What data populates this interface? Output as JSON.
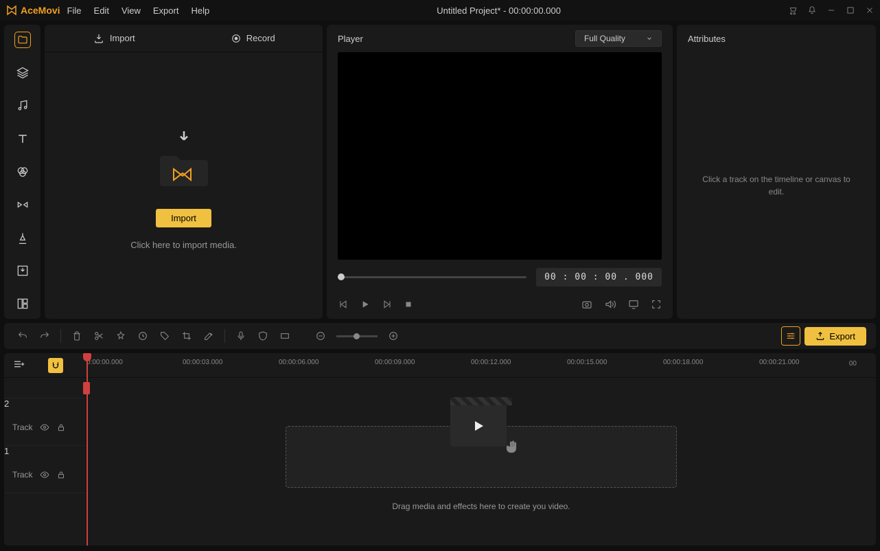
{
  "app": {
    "name": "AceMovi",
    "title": "Untitled Project* - 00:00:00.000"
  },
  "menu": [
    "File",
    "Edit",
    "View",
    "Export",
    "Help"
  ],
  "media": {
    "tabs": {
      "import": "Import",
      "record": "Record"
    },
    "import_btn": "Import",
    "import_hint": "Click here to import media."
  },
  "player": {
    "label": "Player",
    "quality": "Full Quality",
    "time": "00 : 00 : 00 . 000"
  },
  "attributes": {
    "label": "Attributes",
    "hint": "Click a track on the timeline or canvas to edit."
  },
  "toolbar": {
    "export": "Export"
  },
  "timeline": {
    "marks": [
      "0:00:00.000",
      "00:00:03.000",
      "00:00:06.000",
      "00:00:09.000",
      "00:00:12.000",
      "00:00:15.000",
      "00:00:18.000",
      "00:00:21.000"
    ],
    "end_count": "00",
    "tracks": [
      {
        "num": "2",
        "label": "Track"
      },
      {
        "num": "1",
        "label": "Track"
      }
    ],
    "drop_hint": "Drag media and effects here to create you video."
  }
}
